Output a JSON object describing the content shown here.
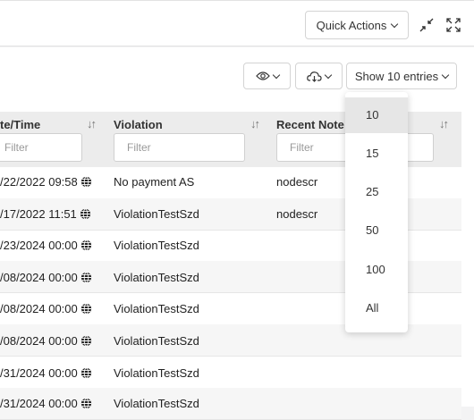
{
  "toolbar": {
    "quick_actions_label": "Quick Actions"
  },
  "table_controls": {
    "show_entries_label": "Show 10 entries"
  },
  "columns": [
    {
      "label": "te/Time",
      "filter_placeholder": "Filter"
    },
    {
      "label": "Violation",
      "filter_placeholder": "Filter"
    },
    {
      "label": "Recent Note",
      "filter_placeholder": "Filter"
    }
  ],
  "rows": [
    {
      "datetime": "/22/2022 09:58",
      "violation": "No payment AS",
      "note": "nodescr"
    },
    {
      "datetime": "/17/2022 11:51",
      "violation": "ViolationTestSzd",
      "note": "nodescr"
    },
    {
      "datetime": "/23/2024 00:00",
      "violation": "ViolationTestSzd",
      "note": ""
    },
    {
      "datetime": "/08/2024 00:00",
      "violation": "ViolationTestSzd",
      "note": ""
    },
    {
      "datetime": "/08/2024 00:00",
      "violation": "ViolationTestSzd",
      "note": ""
    },
    {
      "datetime": "/08/2024 00:00",
      "violation": "ViolationTestSzd",
      "note": ""
    },
    {
      "datetime": "/31/2024 00:00",
      "violation": "ViolationTestSzd",
      "note": ""
    },
    {
      "datetime": "/31/2024 00:00",
      "violation": "ViolationTestSzd",
      "note": ""
    }
  ],
  "page_length_options": [
    "10",
    "15",
    "25",
    "50",
    "100",
    "All"
  ],
  "selected_page_length": "10",
  "icons": [
    "chevron-down-icon",
    "collapse-icon",
    "expand-icon",
    "eye-icon",
    "cloud-download-icon",
    "sort-icon",
    "globe-icon"
  ]
}
